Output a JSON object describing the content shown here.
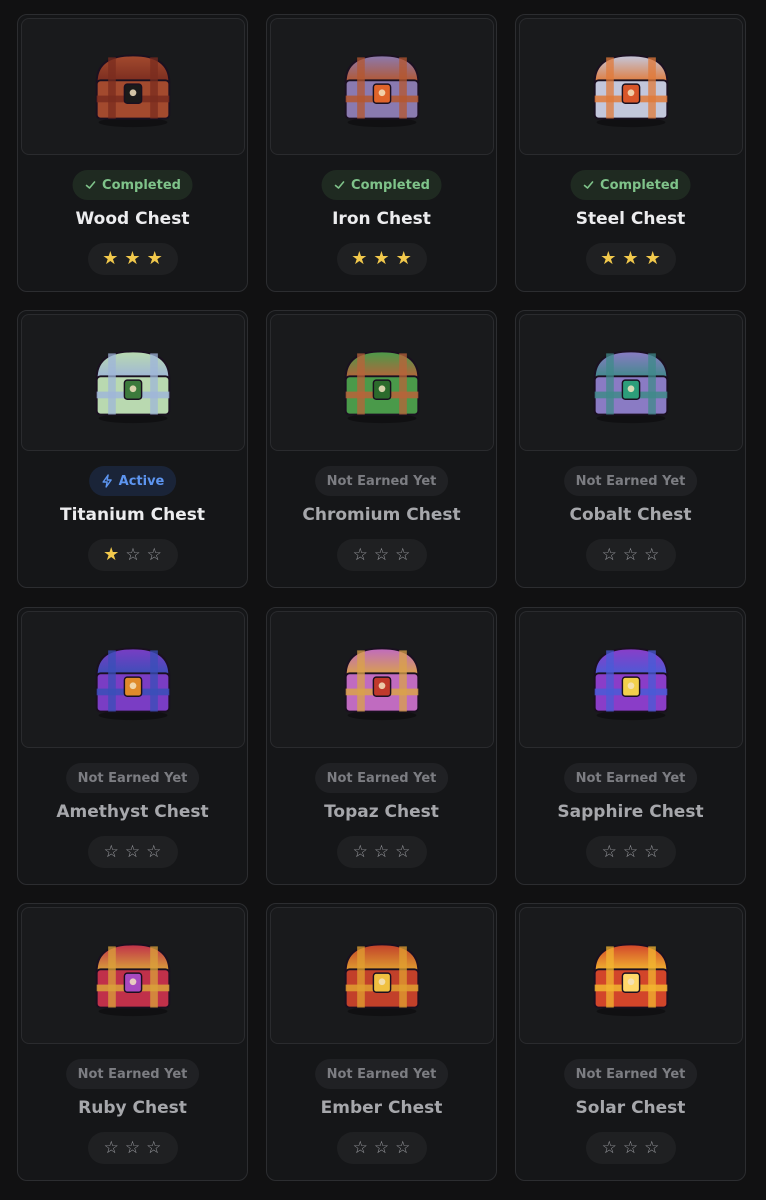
{
  "colors": {
    "background": "#111112",
    "completed": "#7fc38a",
    "active": "#5d95f0",
    "not_earned": "#7c7d82",
    "star_filled": "#f2c94c"
  },
  "chests": [
    {
      "name": "Wood Chest",
      "status": "completed",
      "status_label": "Completed",
      "status_icon": "check-icon",
      "stars_earned": 3,
      "stars_total": 3,
      "art": "wood-chest-icon",
      "primary": "#a34a2e",
      "secondary": "#7a2c1f",
      "accent": "#1a1a1a"
    },
    {
      "name": "Iron Chest",
      "status": "completed",
      "status_label": "Completed",
      "status_icon": "check-icon",
      "stars_earned": 3,
      "stars_total": 3,
      "art": "iron-chest-icon",
      "primary": "#8a7ab0",
      "secondary": "#b4572f",
      "accent": "#e0642a"
    },
    {
      "name": "Steel Chest",
      "status": "completed",
      "status_label": "Completed",
      "status_icon": "check-icon",
      "stars_earned": 3,
      "stars_total": 3,
      "art": "steel-chest-icon",
      "primary": "#c3c7dc",
      "secondary": "#e07a3a",
      "accent": "#d9562a"
    },
    {
      "name": "Titanium Chest",
      "status": "active",
      "status_label": "Active",
      "status_icon": "lightning-icon",
      "stars_earned": 1,
      "stars_total": 3,
      "art": "titanium-chest-icon",
      "primary": "#b9d9b0",
      "secondary": "#9fb6d8",
      "accent": "#3c7a3c"
    },
    {
      "name": "Chromium Chest",
      "status": "not_earned",
      "status_label": "Not Earned Yet",
      "status_icon": "",
      "stars_earned": 0,
      "stars_total": 3,
      "art": "chromium-chest-icon",
      "primary": "#4a9a4a",
      "secondary": "#b8633a",
      "accent": "#2c6b2c"
    },
    {
      "name": "Cobalt Chest",
      "status": "not_earned",
      "status_label": "Not Earned Yet",
      "status_icon": "",
      "stars_earned": 0,
      "stars_total": 3,
      "art": "cobalt-chest-icon",
      "primary": "#8a7bc4",
      "secondary": "#3f8a8a",
      "accent": "#2d9e7a"
    },
    {
      "name": "Amethyst Chest",
      "status": "not_earned",
      "status_label": "Not Earned Yet",
      "status_icon": "",
      "stars_earned": 0,
      "stars_total": 3,
      "art": "amethyst-chest-icon",
      "primary": "#7a3dc4",
      "secondary": "#3a4fb8",
      "accent": "#e08a2a"
    },
    {
      "name": "Topaz Chest",
      "status": "not_earned",
      "status_label": "Not Earned Yet",
      "status_icon": "",
      "stars_earned": 0,
      "stars_total": 3,
      "art": "topaz-chest-icon",
      "primary": "#c06bc0",
      "secondary": "#d9a24a",
      "accent": "#c0392b"
    },
    {
      "name": "Sapphire Chest",
      "status": "not_earned",
      "status_label": "Not Earned Yet",
      "status_icon": "",
      "stars_earned": 0,
      "stars_total": 3,
      "art": "sapphire-chest-icon",
      "primary": "#8a3dc8",
      "secondary": "#4a5bd6",
      "accent": "#f2d04c"
    },
    {
      "name": "Ruby Chest",
      "status": "not_earned",
      "status_label": "Not Earned Yet",
      "status_icon": "",
      "stars_earned": 0,
      "stars_total": 3,
      "art": "ruby-chest-icon",
      "primary": "#c0304a",
      "secondary": "#d9a23a",
      "accent": "#a84ac0"
    },
    {
      "name": "Ember Chest",
      "status": "not_earned",
      "status_label": "Not Earned Yet",
      "status_icon": "",
      "stars_earned": 0,
      "stars_total": 3,
      "art": "ember-chest-icon",
      "primary": "#c2402a",
      "secondary": "#e0a030",
      "accent": "#f0c040"
    },
    {
      "name": "Solar Chest",
      "status": "not_earned",
      "status_label": "Not Earned Yet",
      "status_icon": "",
      "stars_earned": 0,
      "stars_total": 3,
      "art": "solar-chest-icon",
      "primary": "#d2452a",
      "secondary": "#f2b630",
      "accent": "#ffd86a"
    }
  ]
}
